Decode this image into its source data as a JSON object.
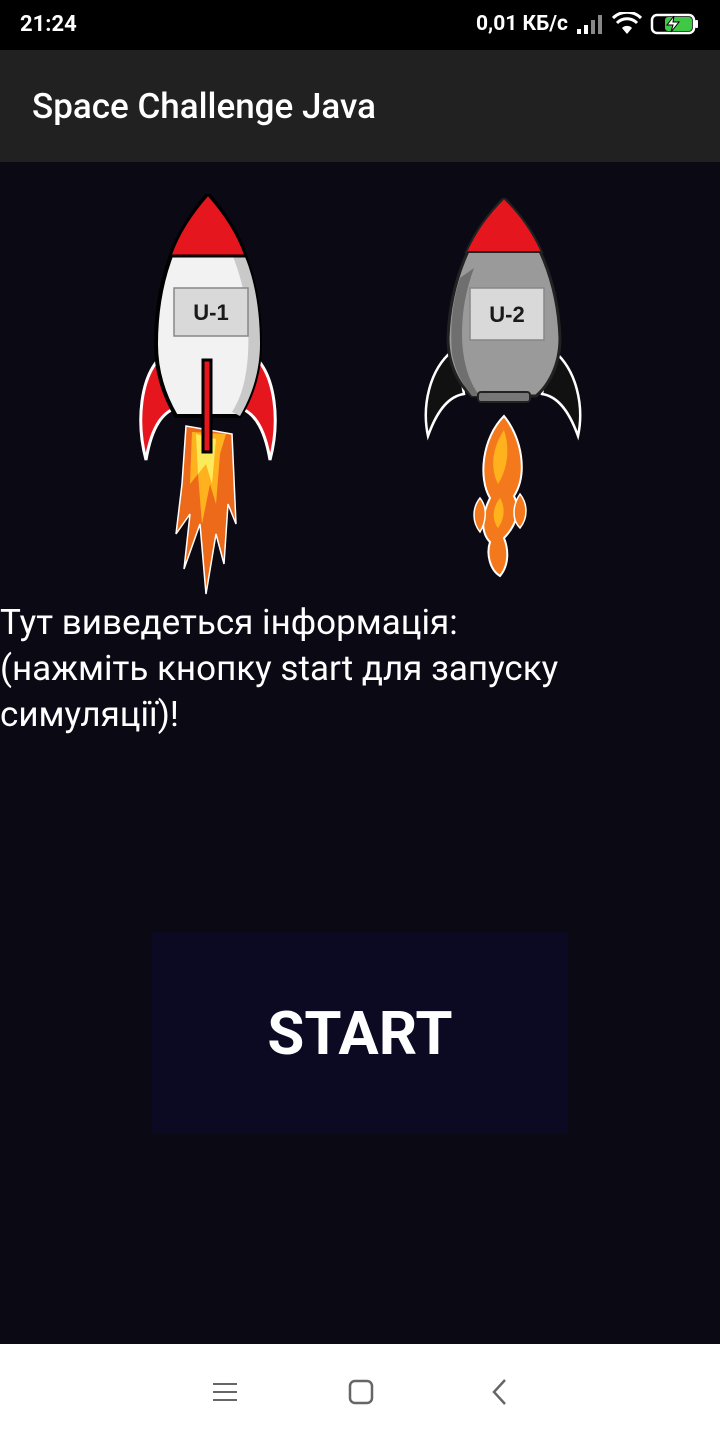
{
  "status_bar": {
    "time": "21:24",
    "net_speed": "0,01 КБ/с",
    "icons": [
      "signal-icon",
      "wifi-icon",
      "battery-charging-icon"
    ]
  },
  "app_bar": {
    "title": "Space Challenge Java"
  },
  "rockets": [
    {
      "name": "rocket-u1",
      "label": "U-1",
      "body_color": "#f2f2f2",
      "accent": "#e5161d"
    },
    {
      "name": "rocket-u2",
      "label": "U-2",
      "body_color": "#9a9a9a",
      "accent": "#e5161d"
    }
  ],
  "info": {
    "text": "Тут виведеться інформація:\n(нажміть кнопку start для запуску\nсимуляції)!"
  },
  "start_button": {
    "label": "START"
  },
  "nav_bar": {
    "icons": [
      "menu-icon",
      "home-icon",
      "back-icon"
    ]
  },
  "colors": {
    "background": "#0b0914",
    "app_bar": "#212121",
    "button": "#0c0a23",
    "accent": "#e5161d"
  }
}
